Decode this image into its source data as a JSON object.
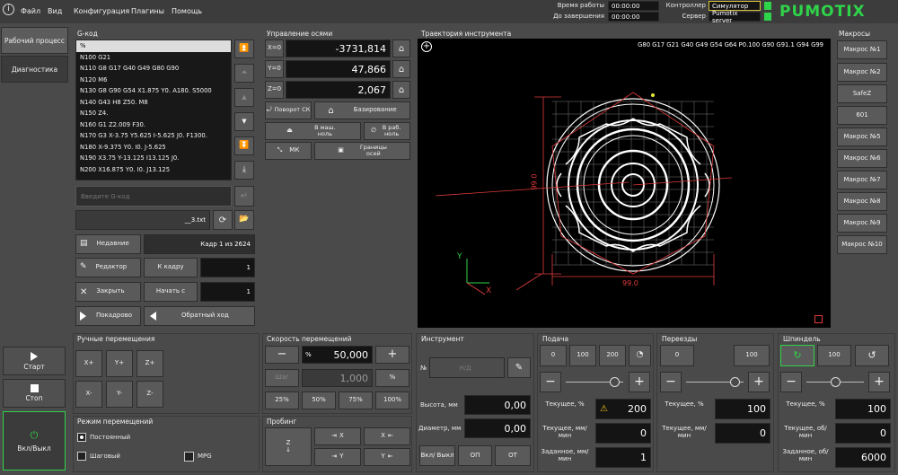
{
  "menu": {
    "items": [
      "Файл",
      "Вид",
      "Конфигурация",
      "Плагины",
      "Помощь"
    ]
  },
  "status": {
    "work_time_label": "Время работы",
    "work_time": "00:00:00",
    "remaining_label": "До завершения",
    "remaining": "00:00:00",
    "controller_label": "Контроллер",
    "controller": "Симулятор",
    "server_label": "Сервер",
    "server": "Pumotix server",
    "brand": "PUMOTIX",
    "led_color": "#2fd34a",
    "brand_color": "#2fd34a"
  },
  "left_nav": {
    "work": "Рабочий процесс",
    "diag": "Диагностика",
    "start": "Старт",
    "stop": "Стоп",
    "power": "Вкл/Выкл"
  },
  "gcode": {
    "title": "G-код",
    "lines": [
      "%",
      "N100 G21",
      "N110 G8 G17 G40 G49 G80 G90",
      "N120 M6",
      "N130 G8 G90 G54 X1.875 Y0. A180. S5000",
      "N140 G43 H8 Z50. M8",
      "N150 Z4.",
      "N160 G1 Z2.009 F30.",
      "N170 G3 X-3.75 Y5.625 I-5.625 J0. F1300.",
      "N180 X-9.375 Y0. I0. J-5.625",
      "N190 X3.75 Y-13.125 I13.125 J0.",
      "N200 X16.875 Y0. I0. J13.125"
    ],
    "input_placeholder": "Введите G-код",
    "filename": "__3.txt",
    "recent": "Недавние",
    "frame": "Кадр 1 из 2624",
    "editor": "Редактор",
    "to_frame": "К кадру",
    "to_frame_value": "1",
    "close": "Закрыть",
    "start_from": "Начать с",
    "start_from_value": "1",
    "step": "Покадрово",
    "reverse": "Обратный ход"
  },
  "axes": {
    "title": "Управление осями",
    "x_label": "X=0",
    "x": "-3731,814",
    "y_label": "Y=0",
    "y": "47,866",
    "z_label": "Z=0",
    "z": "2,067",
    "rotate": "Поворот СК",
    "homing": "Базирование",
    "to_machine_zero": "В маш. ноль",
    "to_work_zero": "В раб. ноль",
    "mk": "МК",
    "limits": "Границы осей"
  },
  "trajectory": {
    "title": "Траектория инструмента",
    "modal": "G80 G17 G21 G40 G49 G54 G64 P0.100 G90 G91.1 G94 G99",
    "dim_x": "99.0",
    "dim_y": "99.0",
    "axis_x": "X",
    "axis_y": "Y"
  },
  "macros": {
    "title": "Макросы",
    "items": [
      "Макрос №1",
      "Макрос №2",
      "SafeZ",
      "601",
      "Макрос №5",
      "Макрос №6",
      "Макрос №7",
      "Макрос №8",
      "Макрос №9",
      "Макрос №10"
    ]
  },
  "jog": {
    "title": "Ручные перемещения",
    "xp": "X+",
    "yp": "Y+",
    "zp": "Z+",
    "xm": "X-",
    "ym": "Y-",
    "zm": "Z-"
  },
  "mode": {
    "title": "Режим перемещений",
    "continuous": "Постоянный",
    "step": "Шаговый",
    "mpg": "MPG"
  },
  "speed": {
    "title": "Скорость перемещений",
    "value": "50,000",
    "pct": "%",
    "step_label": "Шаг",
    "step_value": "1,000",
    "p25": "25%",
    "p50": "50%",
    "p75": "75%",
    "p100": "100%"
  },
  "probe": {
    "title": "Пробинг",
    "z": "Z",
    "x1": "X",
    "x2": "X",
    "y1": "Y",
    "y2": "Y"
  },
  "tool": {
    "title": "Инструмент",
    "num": "№",
    "name": "Н/Д",
    "height_label": "Высота, мм",
    "height": "0,00",
    "diam_label": "Диаметр, мм",
    "diam": "0,00",
    "onoff": "Вкл/ Выкл",
    "op": "ОП",
    "ot": "ОТ"
  },
  "feed": {
    "title": "Подача",
    "b0": "0",
    "b100": "100",
    "b200": "200",
    "cur_label": "Текущее, %",
    "cur": "200",
    "mm_label": "Текущее, мм/мин",
    "mm": "0",
    "set_label": "Заданное, мм/мин",
    "set": "1",
    "slider": 0.85
  },
  "rapid": {
    "title": "Переезды",
    "b0": "0",
    "b100": "100",
    "cur_label": "Текущее, %",
    "cur": "100",
    "mm_label": "Текущее, мм/мин",
    "mm": "0",
    "slider": 0.85
  },
  "spindle": {
    "title": "Шпиндель",
    "b100": "100",
    "cur_label": "Текущее, %",
    "cur": "100",
    "rpm_label": "Текущее, об/мин",
    "rpm": "0",
    "set_label": "Заданное, об/мин",
    "set": "6000",
    "slider": 0.5
  }
}
